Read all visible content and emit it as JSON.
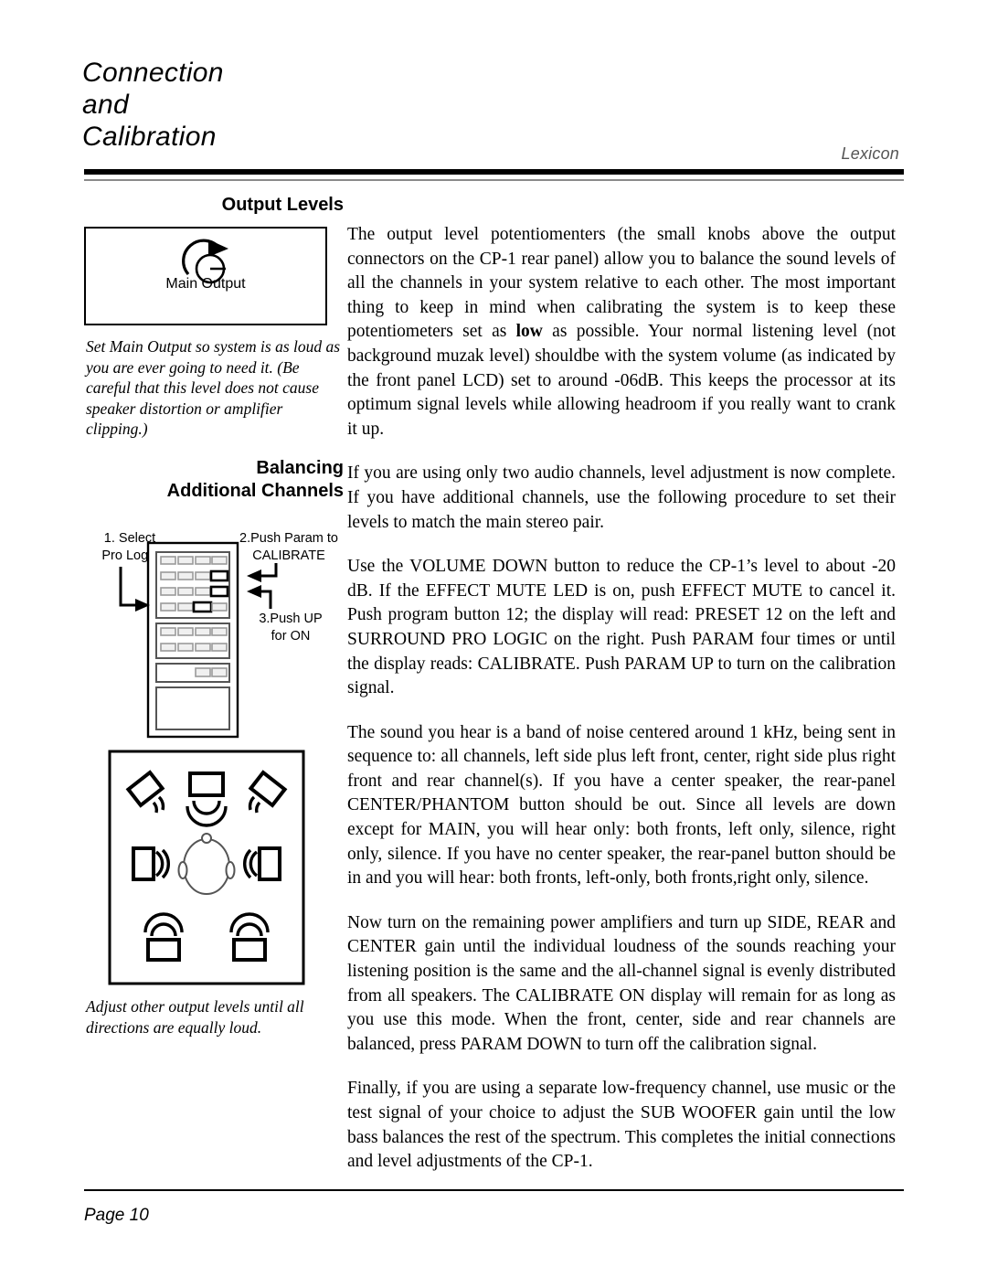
{
  "header": {
    "title_lines": [
      "Connection",
      "and",
      "Calibration"
    ],
    "brand": "Lexicon",
    "brand_color": "#555555"
  },
  "sidebar": {
    "section1": {
      "heading_lines": [
        "Output Levels"
      ],
      "diagram": {
        "name": "main-output-knob",
        "label": "Main Output",
        "rotation_direction": "clockwise"
      },
      "caption": "Set Main Output so  system is as loud as you are ever going to need it. (Be careful that this level does not cause speaker distortion or amplifier clipping.)"
    },
    "section2": {
      "heading_lines": [
        "Balancing",
        "Additional Channels"
      ],
      "remote_diagram": {
        "name": "cp-1-remote-control",
        "annotations": [
          {
            "id": "step-1",
            "lines": [
              "1. Select",
              "Pro Logic"
            ],
            "points_to": "left-side-of-remote"
          },
          {
            "id": "step-2",
            "lines": [
              "2.Push Param to",
              "CALIBRATE"
            ],
            "points_to": "row-2-right-button"
          },
          {
            "id": "step-3",
            "lines": [
              "3.Push UP",
              "for ON"
            ],
            "points_to": "row-3-right-button"
          }
        ],
        "button_grid": {
          "group_a_rows": 4,
          "group_a_cols": 4,
          "group_b_rows": 2,
          "group_b_cols": 4,
          "highlighted_buttons": [
            "r2c4",
            "r3c4",
            "r4c3"
          ],
          "bottom_row_buttons": 2
        }
      },
      "speaker_diagram": {
        "name": "speaker-placement-layout",
        "elements": [
          "front-left-speaker",
          "front-center-speaker",
          "front-right-speaker",
          "side-left-speaker",
          "listener-head",
          "side-right-speaker",
          "rear-left-speaker",
          "rear-right-speaker"
        ]
      },
      "caption": "Adjust other output levels until all directions are equally loud."
    }
  },
  "body": {
    "paragraphs": [
      {
        "id": "p1",
        "runs": [
          {
            "text": "The output level potentiomenters (the small knobs above the output connectors on the CP-1 rear panel) allow you to balance the sound levels of all the channels in your system relative to each other. The most important thing to keep in mind when calibrating the system is to keep these potentiometers set as ",
            "bold": false
          },
          {
            "text": "low",
            "bold": true
          },
          {
            "text": " as possible. Your normal listening level (not background muzak level) shouldbe with the system volume (as indicated by the front panel LCD) set to around -06dB. This keeps the processor at its optimum signal levels while allowing headroom if you really want to crank it up.",
            "bold": false
          }
        ]
      },
      {
        "id": "p2",
        "runs": [
          {
            "text": "If you are using only two audio channels, level adjustment is now complete. If you have additional channels, use the following procedure to set their levels to match the main stereo pair.",
            "bold": false
          }
        ]
      },
      {
        "id": "p3",
        "runs": [
          {
            "text": "Use the VOLUME DOWN button to reduce the CP-1’s level to about -20 dB. If the EFFECT MUTE LED is on, push EFFECT MUTE to cancel it.  Push program button 12;  the display will read: PRESET 12 on  the left and SURROUND PRO LOGIC  on the right.  Push PARAM  four times or until the display reads: CALIBRATE.  Push PARAM UP to turn on the calibration signal.",
            "bold": false
          }
        ]
      },
      {
        "id": "p4",
        "runs": [
          {
            "text": "The sound you hear is a band of noise centered around 1 kHz, being sent in sequence to: all channels, left side plus left front, center, right side plus right front  and rear channel(s).  If you have a center speaker, the rear-panel CENTER/PHANTOM button should be out.  Since all levels are down except for MAIN, you will hear only: both fronts, left only, silence, right only, silence.  If you have no center speaker, the rear-panel button should be in and you will hear: both fronts, left-only, both fronts,right only, silence.",
            "bold": false
          }
        ]
      },
      {
        "id": "p5",
        "runs": [
          {
            "text": "Now  turn on the remaining power amplifiers and turn up  SIDE, REAR  and CENTER gain until the individual loudness of the sounds reaching your listening position is the same and the all-channel signal is evenly distributed from all speakers.  The CALIBRATE ON display will remain for as long as you use this mode.  When the front, center, side and rear channels are balanced, press PARAM DOWN to turn off the calibration signal.",
            "bold": false
          }
        ]
      },
      {
        "id": "p6",
        "runs": [
          {
            "text": "Finally, if you are using a separate low-frequency channel, use music or the test signal of your choice to adjust the SUB WOOFER gain until the low bass balances the rest of the spectrum.  This completes the initial connections and level adjustments of the CP-1.",
            "bold": false
          }
        ]
      }
    ]
  },
  "footer": {
    "page_label": "Page 10"
  }
}
